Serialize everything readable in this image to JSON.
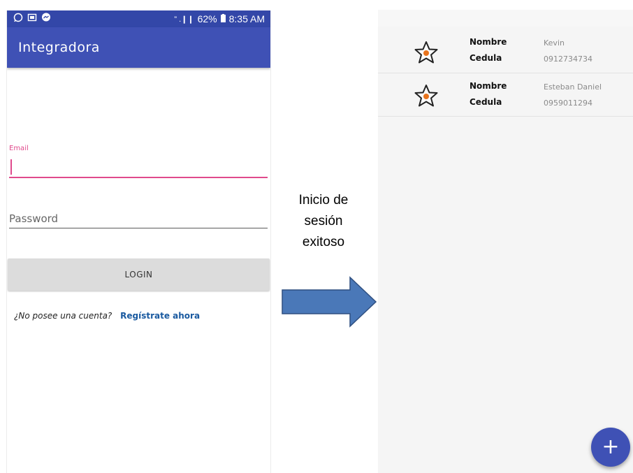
{
  "login_screen": {
    "status_bar": {
      "signal": "” .❙❙",
      "battery": "62%",
      "time": "8:35 AM"
    },
    "app_title": "Integradora",
    "email": {
      "label": "Email",
      "value": ""
    },
    "password": {
      "placeholder": "Password"
    },
    "login_button": "LOGIN",
    "register_prompt": "¿No posee una cuenta?",
    "register_link": "Regístrate ahora",
    "colors": {
      "primary": "#3f51b5",
      "status_bar": "#3347a8",
      "accent": "#e04a8c"
    }
  },
  "transition": {
    "caption_lines": [
      "Inicio de",
      "sesión",
      "exitoso"
    ],
    "arrow_color": "#4a78b8"
  },
  "list_screen": {
    "field_labels": {
      "name": "Nombre",
      "id": "Cedula"
    },
    "items": [
      {
        "icon": "star-icon",
        "name": "Kevin",
        "id": "0912734734"
      },
      {
        "icon": "star-icon",
        "name": "Esteban Daniel",
        "id": "0959011294"
      }
    ],
    "fab": {
      "icon": "plus-icon",
      "symbol": "+"
    }
  }
}
